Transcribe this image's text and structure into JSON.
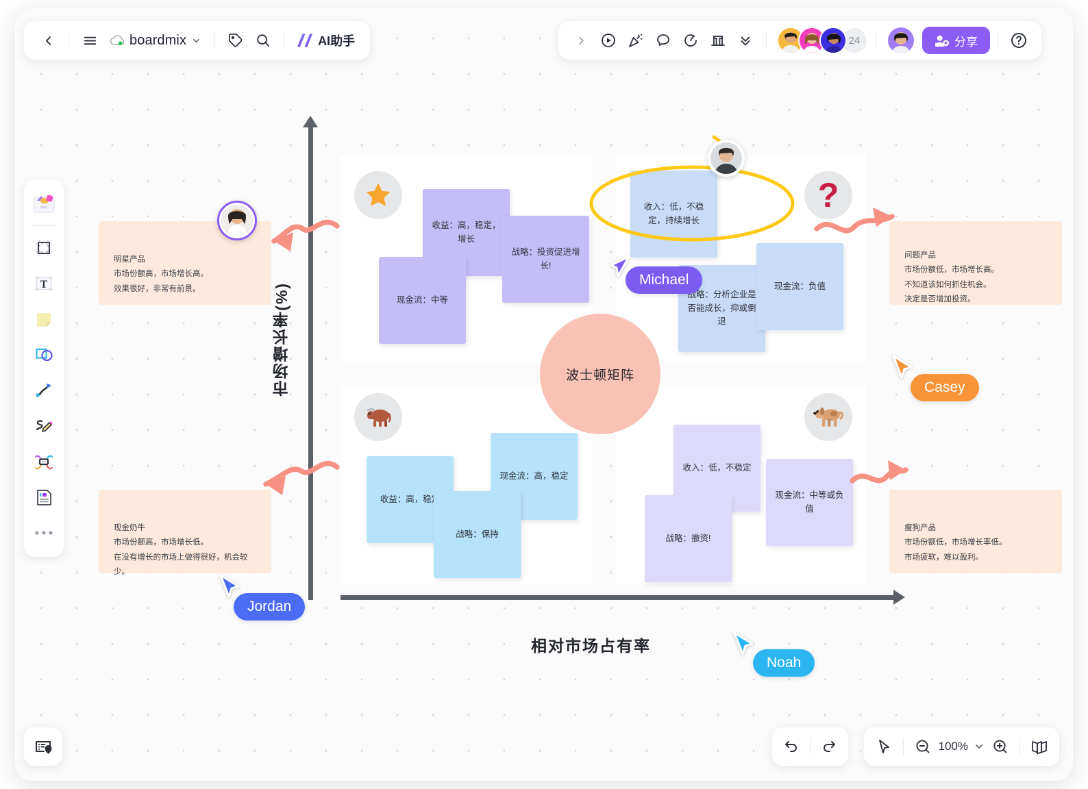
{
  "app": {
    "brand": "boardmix",
    "ai_label": "AI助手",
    "share_label": "分享",
    "collaborator_count": "24",
    "zoom_level": "100%"
  },
  "toolbar_left": {
    "back_icon": "chevron-left-icon",
    "menu_icon": "hamburger-menu-icon",
    "brand_icon": "cloud-icon",
    "brand_caret": "chevron-down-icon",
    "tag_icon": "tag-icon",
    "search_icon": "search-icon",
    "ai_icon": "ai-sparkle-icon"
  },
  "toolbar_right": {
    "expand_icon": "chevron-right-icon",
    "present_icon": "play-circle-icon",
    "celebrate_icon": "party-popper-icon",
    "comment_icon": "speech-bubble-icon",
    "timer_icon": "timer-icon",
    "vote_icon": "chart-bar-icon",
    "more_icon": "chevron-double-down-icon",
    "help_icon": "help-circle-icon"
  },
  "tool_rail": {
    "items": [
      {
        "name": "templates-tool",
        "icon": "templates-icon"
      },
      {
        "name": "frame-tool",
        "icon": "frame-icon"
      },
      {
        "name": "text-tool",
        "icon": "text-t-icon"
      },
      {
        "name": "sticky-note-tool",
        "icon": "sticky-note-icon"
      },
      {
        "name": "shape-tool",
        "icon": "shapes-icon"
      },
      {
        "name": "connector-tool",
        "icon": "curved-arrow-icon"
      },
      {
        "name": "pen-tool",
        "icon": "pencil-scribble-icon"
      },
      {
        "name": "mindmap-tool",
        "icon": "mindmap-icon"
      },
      {
        "name": "document-tool",
        "icon": "document-card-icon"
      },
      {
        "name": "more-tools",
        "icon": "ellipsis-icon"
      }
    ]
  },
  "bottom_bar": {
    "locate_icon": "locate-card-icon",
    "undo_icon": "undo-arrow-icon",
    "redo_icon": "redo-arrow-icon",
    "select_icon": "cursor-arrow-icon",
    "zoom_out_icon": "minus-circle-icon",
    "zoom_in_icon": "plus-circle-icon",
    "zoom_caret": "chevron-down-icon",
    "minimap_icon": "open-book-icon"
  },
  "chart_data": {
    "type": "matrix",
    "title": "波士顿矩阵",
    "xlabel": "相对市场占有率",
    "ylabel": "市场增长率(%)",
    "quadrants": [
      {
        "id": "star",
        "position": "top-left",
        "icon": "star-icon",
        "notes": [
          {
            "text": "收益：高，稳定，增长",
            "color": "#c4bdf7"
          },
          {
            "text": "战略：投资促进增长!",
            "color": "#c4bdf7"
          },
          {
            "text": "现金流：中等",
            "color": "#c4bdf7"
          }
        ]
      },
      {
        "id": "question-mark",
        "position": "top-right",
        "icon": "question-mark-icon",
        "notes": [
          {
            "text": "收入：低，不稳定，持续增长",
            "color": "#c8dcf8"
          },
          {
            "text": "战略：分析企业是否能成长，抑或倒退",
            "color": "#c8dcf8"
          },
          {
            "text": "现金流：负值",
            "color": "#c8dcf8"
          }
        ]
      },
      {
        "id": "cash-cow",
        "position": "bottom-left",
        "icon": "cow-icon",
        "notes": [
          {
            "text": "收益：高，稳定",
            "color": "#b6e2fa"
          },
          {
            "text": "现金流：高，稳定",
            "color": "#b6e2fa"
          },
          {
            "text": "战略：保持",
            "color": "#b6e2fa"
          }
        ]
      },
      {
        "id": "dog",
        "position": "bottom-right",
        "icon": "dog-icon",
        "notes": [
          {
            "text": "收入：低，不稳定",
            "color": "#ddd9fa"
          },
          {
            "text": "现金流：中等或负值",
            "color": "#ddd9fa"
          },
          {
            "text": "战略：撤资!",
            "color": "#ddd9fa"
          }
        ]
      }
    ],
    "callouts": [
      {
        "id": "star-callout",
        "position": "top-left",
        "text": "明星产品\n市场份额高，市场增长高。\n效果很好，非常有前景。"
      },
      {
        "id": "question-callout",
        "position": "top-right",
        "text": "问题产品\n市场份额低，市场增长高。\n不知道该如何抓住机会。\n决定是否增加投资。"
      },
      {
        "id": "cow-callout",
        "position": "bottom-left",
        "text": "现金奶牛\n市场份额高，市场增长低。\n在没有增长的市场上做得很好，机会较少。"
      },
      {
        "id": "dog-callout",
        "position": "bottom-right",
        "text": "瘦狗产品\n市场份额低，市场增长率低。\n市场疲软，难以盈利。"
      }
    ]
  },
  "cursors": [
    {
      "name": "Michael",
      "color": "#7c5cf0"
    },
    {
      "name": "Casey",
      "color": "#f99337"
    },
    {
      "name": "Jordan",
      "color": "#4a6cf7"
    },
    {
      "name": "Noah",
      "color": "#2bb6f2"
    }
  ]
}
